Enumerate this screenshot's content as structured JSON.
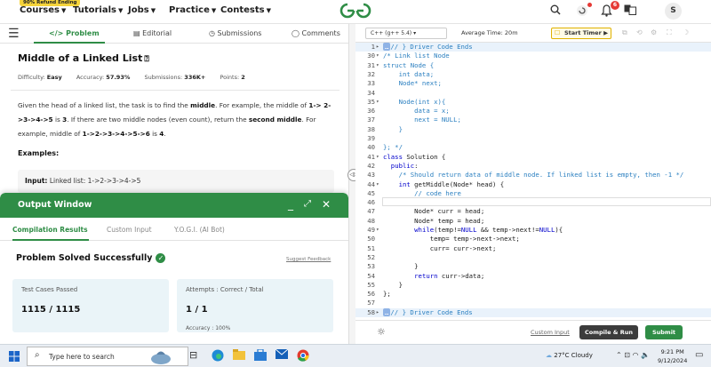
{
  "nav": {
    "promo": "90% Refund Ending",
    "items": [
      "Courses",
      "Tutorials",
      "Jobs",
      "Practice",
      "Contests"
    ],
    "logo": "GG",
    "notification_count": "6",
    "avatar_initial": "S"
  },
  "left_tabs": [
    "Problem",
    "Editorial",
    "Submissions",
    "Comments"
  ],
  "problem": {
    "title": "Middle of a Linked List",
    "difficulty_label": "Difficulty:",
    "difficulty": "Easy",
    "accuracy_label": "Accuracy:",
    "accuracy": "57.93%",
    "submissions_label": "Submissions:",
    "submissions": "336K+",
    "points_label": "Points:",
    "points": "2",
    "desc_1": "Given the head of a linked list, the task is to find the ",
    "desc_middle": "middle",
    "desc_2": ". For example, the middle of ",
    "desc_ex1": "1-> 2->3->4->5",
    "desc_3": " is ",
    "desc_ex1_ans": "3",
    "desc_4": ". If there are two middle nodes (even count), return the ",
    "desc_second": "second middle",
    "desc_5": ". For example, middle of ",
    "desc_ex2": "1->2->3->4->5->6",
    "desc_6": " is ",
    "desc_ex2_ans": "4",
    "desc_7": ".",
    "examples_heading": "Examples:",
    "input_label": "Input:",
    "input_value": "Linked list: 1->2->3->4->5"
  },
  "output": {
    "title": "Output Window",
    "tabs": [
      "Compilation Results",
      "Custom Input",
      "Y.O.G.I. (AI Bot)"
    ],
    "status": "Problem Solved Successfully",
    "suggest": "Suggest Feedback",
    "test_cases_label": "Test Cases Passed",
    "test_cases_value": "1115 / 1115",
    "attempts_label": "Attempts : Correct / Total",
    "attempts_value": "1 / 1",
    "accuracy_partial": "Accuracy : 100%"
  },
  "editor": {
    "language": "C++ (g++ 5.4)",
    "avg_time": "Average Time: 20m",
    "timer_label": "Start Timer",
    "custom_input": "Custom Input",
    "compile_label": "Compile & Run",
    "submit_label": "Submit",
    "lines": [
      {
        "n": "1",
        "f": "▸",
        "hl": true,
        "html": "<span class=\"tag\">…</span><span class=\"cm\">// } Driver Code Ends</span>"
      },
      {
        "n": "30",
        "f": "▾",
        "html": "<span class=\"cm\">/* Link list Node</span>"
      },
      {
        "n": "31",
        "f": "▾",
        "html": "<span class=\"cm\">struct Node {</span>"
      },
      {
        "n": "32",
        "f": "",
        "html": "<span class=\"cm\">    int data;</span>"
      },
      {
        "n": "33",
        "f": "",
        "html": "<span class=\"cm\">    Node* next;</span>"
      },
      {
        "n": "34",
        "f": "",
        "html": ""
      },
      {
        "n": "35",
        "f": "▾",
        "html": "<span class=\"cm\">    Node(int x){</span>"
      },
      {
        "n": "36",
        "f": "",
        "html": "<span class=\"cm\">        data = x;</span>"
      },
      {
        "n": "37",
        "f": "",
        "html": "<span class=\"cm\">        next = NULL;</span>"
      },
      {
        "n": "38",
        "f": "",
        "html": "<span class=\"cm\">    }</span>"
      },
      {
        "n": "39",
        "f": "",
        "html": ""
      },
      {
        "n": "40",
        "f": "",
        "html": "<span class=\"cm\">}; */</span>"
      },
      {
        "n": "41",
        "f": "▾",
        "html": "<span class=\"kw\">class</span> Solution {"
      },
      {
        "n": "42",
        "f": "",
        "html": "  <span class=\"kw\">public</span>:"
      },
      {
        "n": "43",
        "f": "",
        "html": "    <span class=\"cm\">/* Should return data of middle node. If linked list is empty, then -1 */</span>"
      },
      {
        "n": "44",
        "f": "▾",
        "html": "    <span class=\"kw\">int</span> getMiddle(Node* head) {"
      },
      {
        "n": "45",
        "f": "",
        "html": "        <span class=\"cm\">// code here</span>"
      },
      {
        "n": "46",
        "f": "",
        "html": ""
      },
      {
        "n": "47",
        "f": "",
        "html": "        Node* curr = head;"
      },
      {
        "n": "48",
        "f": "",
        "html": "        Node* temp = head;"
      },
      {
        "n": "49",
        "f": "▾",
        "html": "        <span class=\"kw\">while</span>(temp!=<span class=\"kw\">NULL</span> &amp;&amp; temp->next!=<span class=\"kw\">NULL</span>){"
      },
      {
        "n": "50",
        "f": "",
        "html": "            temp= temp->next->next;"
      },
      {
        "n": "51",
        "f": "",
        "html": "            curr= curr->next;"
      },
      {
        "n": "52",
        "f": "",
        "html": ""
      },
      {
        "n": "53",
        "f": "",
        "html": "        }"
      },
      {
        "n": "54",
        "f": "",
        "html": "        <span class=\"kw\">return</span> curr->data;"
      },
      {
        "n": "55",
        "f": "",
        "html": "    }"
      },
      {
        "n": "56",
        "f": "",
        "html": "};"
      },
      {
        "n": "57",
        "f": "",
        "html": ""
      },
      {
        "n": "58",
        "f": "▸",
        "hl": true,
        "html": "<span class=\"tag\">…</span><span class=\"cm\">// } Driver Code Ends</span>"
      }
    ]
  },
  "taskbar": {
    "search_placeholder": "Type here to search",
    "weather": "27°C  Cloudy",
    "time": "9:21 PM",
    "date": "9/12/2024"
  }
}
